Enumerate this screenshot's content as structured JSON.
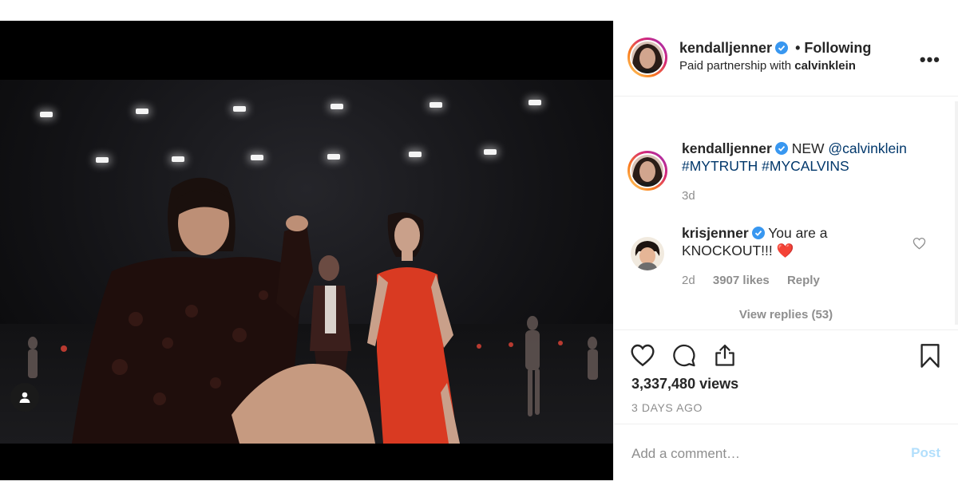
{
  "post": {
    "author": "kendalljenner",
    "follow_status": "• Following",
    "paid_prefix": "Paid partnership with ",
    "partner": "calvinklein"
  },
  "caption": {
    "author": "kendalljenner",
    "text_prefix": "NEW ",
    "mention": "@calvinklein",
    "hashtags": "#MYTRUTH #MYCALVINS",
    "time": "3d"
  },
  "comment": {
    "author": "krisjenner",
    "text": "You are a KNOCKOUT!!!",
    "emoji": "❤️",
    "time": "2d",
    "likes": "3907 likes",
    "reply": "Reply",
    "view_replies": "View replies (53)"
  },
  "stats": {
    "views": "3,337,480 views",
    "posted": "3 DAYS AGO"
  },
  "composer": {
    "placeholder": "Add a comment…",
    "post_label": "Post"
  },
  "icons": {
    "more": "more-options-icon",
    "like": "heart-icon",
    "comment": "comment-bubble-icon",
    "share": "share-icon",
    "save": "bookmark-icon",
    "tag": "user-tag-icon",
    "verified": "verified-badge-icon"
  },
  "colors": {
    "verified_blue": "#3897f0",
    "link_blue": "#00376b",
    "post_disabled": "#b2dffc",
    "dress_red": "#d93a22"
  }
}
